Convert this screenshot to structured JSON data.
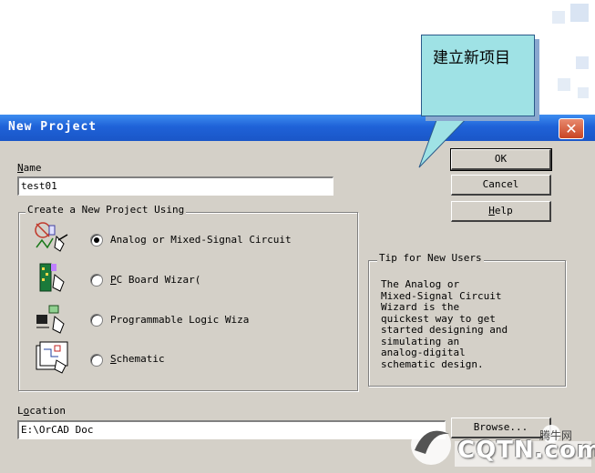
{
  "callout": {
    "text": "建立新项目"
  },
  "dialog": {
    "title": "New Project",
    "close_glyph": "✕",
    "name_label_u": "N",
    "name_label_rest": "ame",
    "name_value": "test01",
    "group_title": "Create a New Project Using",
    "options": [
      {
        "text": "Analog or Mixed-Signal Circuit",
        "selected": true
      },
      {
        "u": "P",
        "rest": "C Board Wizar(",
        "selected": false
      },
      {
        "text": "Programmable Logic Wiza",
        "selected": false
      },
      {
        "u": "S",
        "rest": "chematic",
        "selected": false
      }
    ],
    "tip_title": "Tip for New Users",
    "tip_body": "The Analog or\nMixed-Signal Circuit\nWizard is the\nquickest way to get\nstarted designing and\nsimulating an\nanalog-digital\nschematic design.",
    "location_label_u": "o",
    "location_label_pre": "L",
    "location_label_rest": "cation",
    "location_value": "E:\\OrCAD Doc",
    "buttons": {
      "ok": "OK",
      "cancel": "Cancel",
      "help_u": "H",
      "help_rest": "elp",
      "browse": "Browse..."
    }
  },
  "watermark": {
    "brand": "CQTN.com",
    "site": "腾牛网"
  }
}
